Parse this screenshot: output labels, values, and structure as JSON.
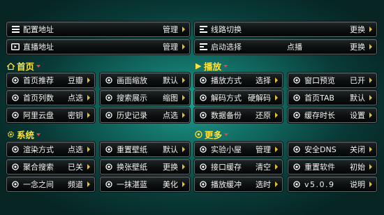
{
  "colors": {
    "accent": "#ffe23a",
    "arrow": "#e8c230",
    "caret": "#e54a3a",
    "background": "#116a61"
  },
  "top": [
    {
      "icon": "list-icon",
      "label": "配置地址",
      "value": "管理"
    },
    {
      "icon": "split-icon",
      "label": "线路切换",
      "value": "更换"
    },
    {
      "icon": "tv-icon",
      "label": "直播地址",
      "value": "管理"
    },
    {
      "icon": "split-icon",
      "label": "启动选择",
      "value": "点播",
      "value2": "更换"
    }
  ],
  "sections": {
    "home": {
      "title": "首页",
      "icon": "home-icon"
    },
    "play": {
      "title": "播放",
      "icon": "play-icon"
    },
    "system": {
      "title": "系统",
      "icon": "gear-icon"
    },
    "more": {
      "title": "更多",
      "icon": "more-icon"
    }
  },
  "home_items": [
    {
      "label": "首页推荐",
      "value": "豆瓣"
    },
    {
      "label": "画面缩放",
      "value": "默认"
    },
    {
      "label": "首页列数",
      "value": "点选"
    },
    {
      "label": "搜索展示",
      "value": "缩图"
    },
    {
      "label": "阿里云盘",
      "value": "密钥"
    },
    {
      "label": "历史记录",
      "value": "点选"
    }
  ],
  "play_items": [
    {
      "label": "播放方式",
      "value": "选择"
    },
    {
      "label": "窗口预览",
      "value": "已开"
    },
    {
      "label": "解码方式",
      "value": "硬解码"
    },
    {
      "label": "首页TAB",
      "value": "默认"
    },
    {
      "label": "数据备份",
      "value": "还原"
    },
    {
      "label": "缓存时长",
      "value": "设置"
    }
  ],
  "system_items": [
    {
      "label": "渲染方式",
      "value": "点选"
    },
    {
      "label": "重置壁纸",
      "value": "默认"
    },
    {
      "label": "聚合搜索",
      "value": "已关"
    },
    {
      "label": "换张壁纸",
      "value": "更换"
    },
    {
      "label": "一念之间",
      "value": "频道"
    },
    {
      "label": "一抹湛蓝",
      "value": "美化"
    }
  ],
  "more_items": [
    {
      "label": "实验小屋",
      "value": "管理"
    },
    {
      "label": "安全DNS",
      "value": "关闭"
    },
    {
      "label": "接口缓存",
      "value": "清空"
    },
    {
      "label": "重置软件",
      "value": "初始"
    },
    {
      "label": "播放缓冲",
      "value": "选时"
    },
    {
      "label": "v5.0.9",
      "value": "说明"
    }
  ]
}
